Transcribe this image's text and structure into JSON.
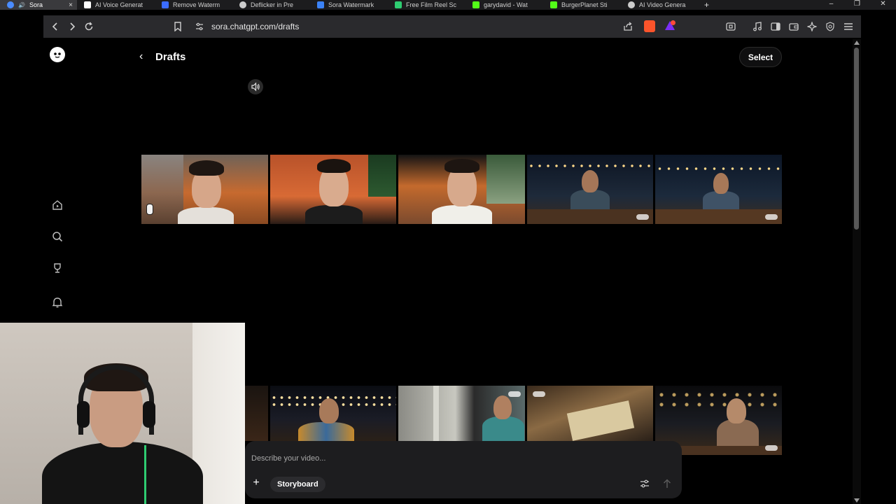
{
  "browser": {
    "tabs": [
      {
        "label": "Sora",
        "active": true,
        "color": "#4a8cff"
      },
      {
        "label": "AI Voice Generat",
        "active": false,
        "color": "#ffffff"
      },
      {
        "label": "Remove Waterm",
        "active": false,
        "color": "#3b6cff"
      },
      {
        "label": "Deflicker in Pre",
        "active": false,
        "color": "#cccccc"
      },
      {
        "label": "Sora Watermark",
        "active": false,
        "color": "#3b82f6"
      },
      {
        "label": "Free Film Reel Sc",
        "active": false,
        "color": "#2ecc71"
      },
      {
        "label": "garydavid - Wat",
        "active": false,
        "color": "#53fc18"
      },
      {
        "label": "BurgerPlanet Sti",
        "active": false,
        "color": "#53fc18"
      },
      {
        "label": "AI Video Genera",
        "active": false,
        "color": "#cccccc"
      }
    ],
    "url": "sora.chatgpt.com/drafts",
    "tab_close": "×",
    "new_tab": "+",
    "window_controls": {
      "minimize": "–",
      "restore": "❐",
      "close": "✕"
    }
  },
  "page": {
    "back_icon": "‹",
    "title": "Drafts",
    "select_label": "Select",
    "composer": {
      "placeholder": "Describe your video...",
      "storyboard_label": "Storyboard",
      "add_label": "+"
    }
  },
  "colors": {
    "accent_red": "#ff4b3a",
    "brave_orange": "#fb542b",
    "background": "#000000"
  },
  "icons": {
    "logo": "sora-logo-icon",
    "home": "home-icon",
    "search": "search-icon",
    "trophy": "trophy-icon",
    "bell": "bell-icon",
    "sound": "speaker-icon",
    "settings": "sliders-icon",
    "send": "arrow-up-icon"
  },
  "thumbnails_row1": [
    {
      "scene": "car-interior",
      "tone": "warm"
    },
    {
      "scene": "car-interior",
      "tone": "warm"
    },
    {
      "scene": "car-interior",
      "tone": "warm"
    },
    {
      "scene": "night-patio",
      "tone": "dark"
    },
    {
      "scene": "night-patio",
      "tone": "dark"
    }
  ],
  "thumbnails_row2": [
    {
      "scene": "night-lights",
      "tone": "dark"
    },
    {
      "scene": "window-service",
      "tone": "neutral"
    },
    {
      "scene": "desk-closeup",
      "tone": "warm"
    },
    {
      "scene": "night-portrait",
      "tone": "dark"
    }
  ]
}
